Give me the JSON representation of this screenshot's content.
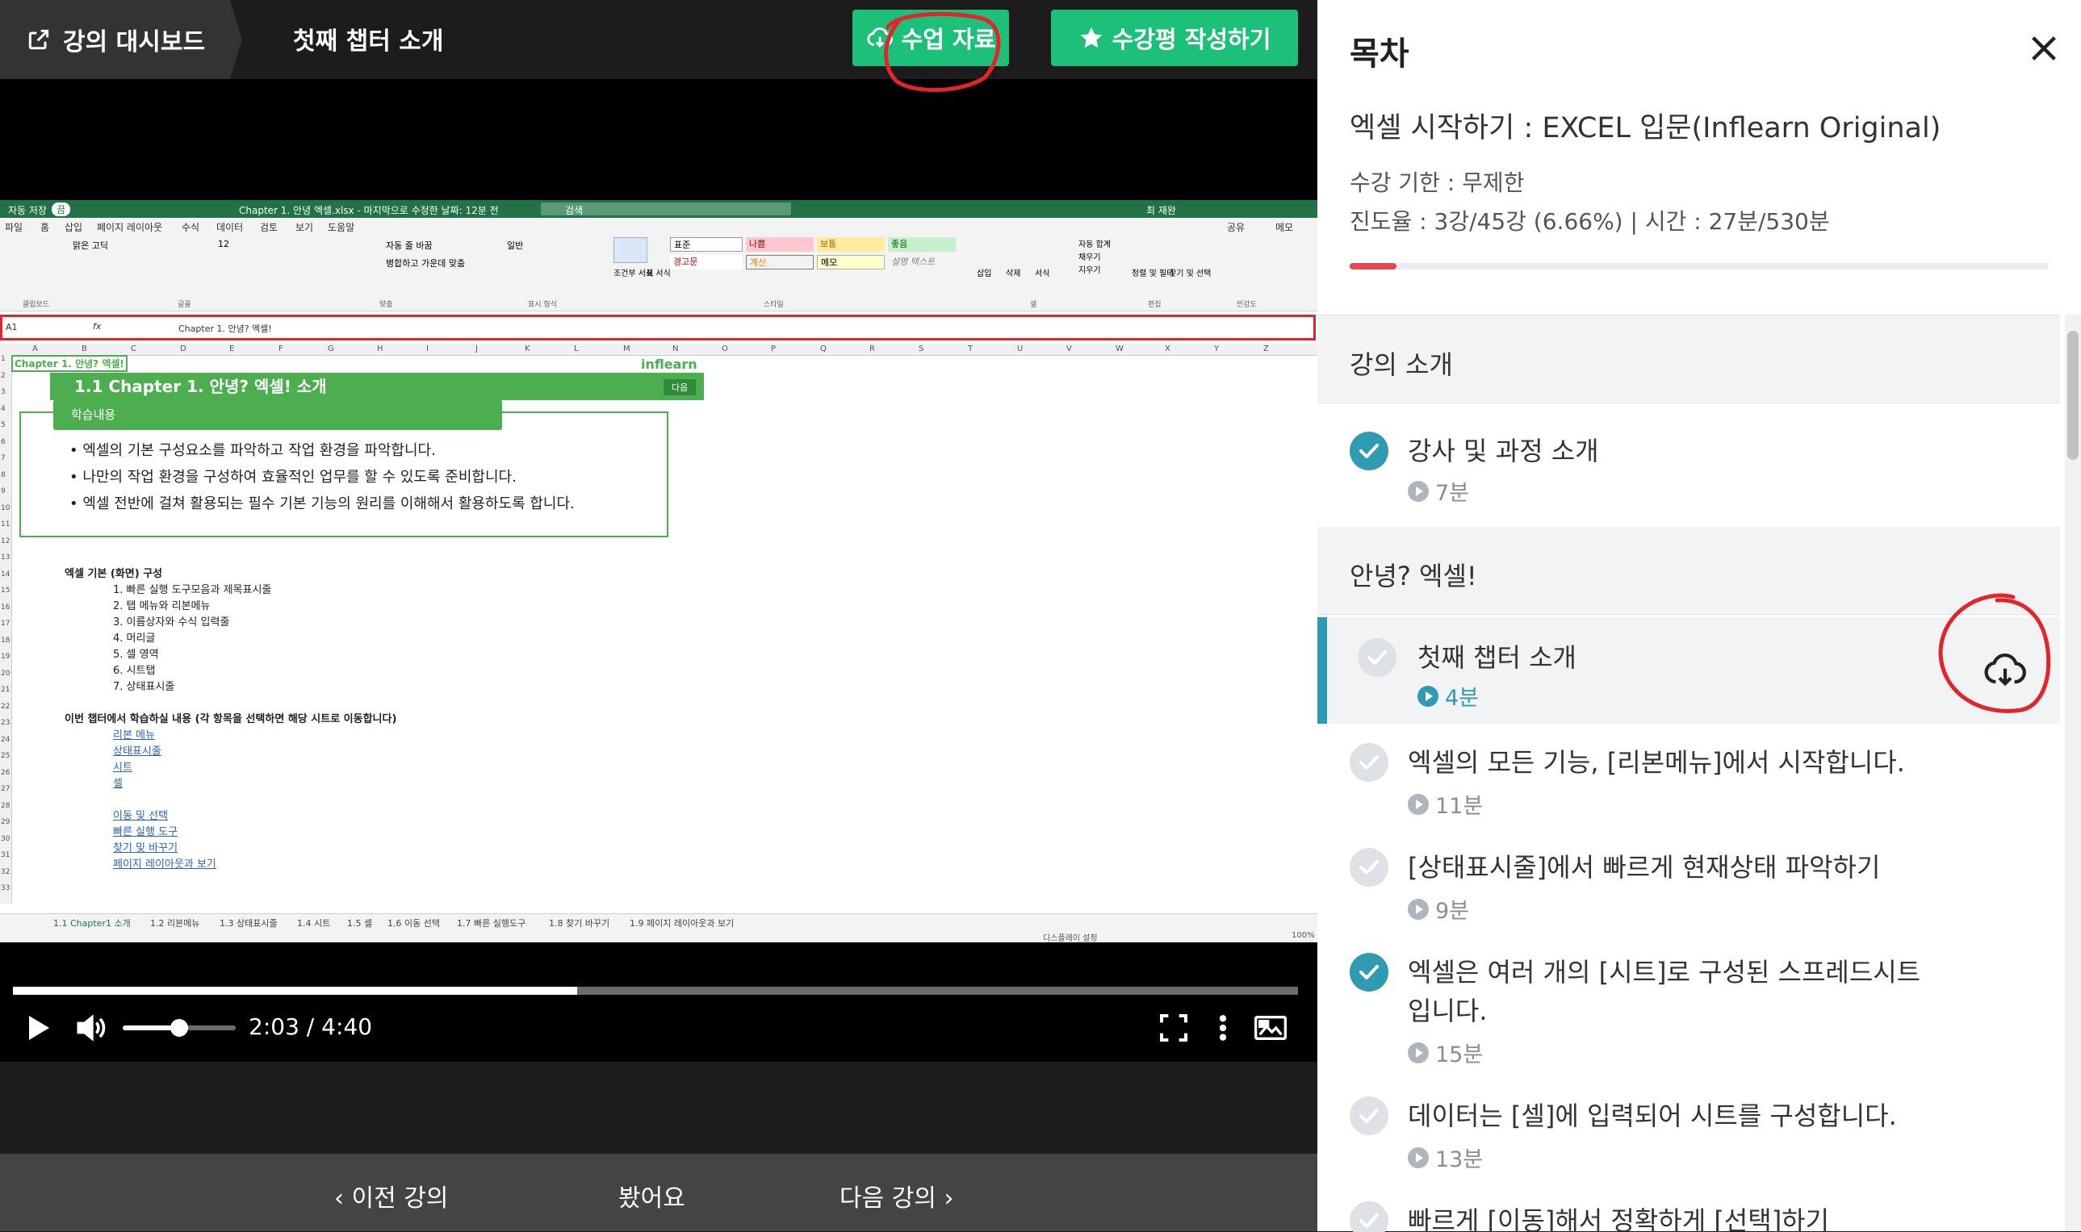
{
  "header": {
    "dashboard_label": "강의 대시보드",
    "chapter_title": "첫째 챕터 소개",
    "material_button": "수업 자료",
    "review_button": "수강평 작성하기"
  },
  "excel": {
    "title_bar": "Chapter 1. 안녕 엑셀.xlsx - 마지막으로 수정한 날짜: 12분 전",
    "search": "검색",
    "user": "최 재완",
    "autosave": "자동 저장",
    "autosave_state": "끔",
    "share": "공유",
    "memo": "메모",
    "menu": [
      "파일",
      "홈",
      "삽입",
      "페이지 레이아웃",
      "수식",
      "데이터",
      "검토",
      "보기",
      "도움말"
    ],
    "ribbon": {
      "font_name": "맑은 고딕",
      "font_size": "12",
      "wrap": "자동 줄 바꿈",
      "merge": "병합하고 가운데 맞춤",
      "number_format": "일반",
      "styles": [
        "표준",
        "나쁨",
        "보통",
        "좋음",
        "경고문",
        "계산",
        "메모",
        "설명 텍스트"
      ],
      "cond_format": "조건부 서식",
      "table_format": "표 서식",
      "cell_insert": "삽입",
      "cell_delete": "삭제",
      "cell_format": "서식",
      "autosum": "자동 합계",
      "fill": "채우기",
      "clear": "지우기",
      "sort": "정렬 및 필터",
      "find": "찾기 및 선택",
      "groups": [
        "클립보드",
        "글꼴",
        "맞춤",
        "표시 형식",
        "스타일",
        "셀",
        "편집",
        "민감도"
      ]
    },
    "name_box": "A1",
    "formula": "Chapter 1. 안녕? 엑셀!",
    "columns": [
      "A",
      "B",
      "C",
      "D",
      "E",
      "F",
      "G",
      "H",
      "I",
      "J",
      "K",
      "L",
      "M",
      "N",
      "O",
      "P",
      "Q",
      "R",
      "S",
      "T",
      "U",
      "V",
      "W",
      "X",
      "Y",
      "Z"
    ],
    "a1_text": "Chapter 1. 안녕? 엑셀!",
    "banner": "1.1 Chapter 1. 안녕? 엑셀! 소개",
    "logo": "inflearn",
    "next_btn": "다음",
    "box_title": "학습내용",
    "bullets": [
      "엑셀의 기본 구성요소를 파악하고 작업 환경을 파악합니다.",
      "나만의 작업 환경을 구성하여 효율적인 업무를 할 수 있도록 준비합니다.",
      "엑셀 전반에 걸쳐 활용되는 필수 기본 기능의 원리를 이해해서 활용하도록 합니다."
    ],
    "section1_title": "엑셀 기본 (화면) 구성",
    "section1_items": [
      "1. 빠른 실행 도구모음과 제목표시줄",
      "2. 탭 메뉴와 리본메뉴",
      "3. 이름상자와 수식 입력줄",
      "4. 머리글",
      "5. 셀 영역",
      "6. 시트탭",
      "7. 상태표시줄"
    ],
    "section2_title": "이번 챕터에서 학습하실 내용 (각 항목을 선택하면 해당 시트로 이동합니다)",
    "links1": [
      "리본 메뉴",
      "상태표시줄",
      "시트",
      "셀"
    ],
    "links2": [
      "이동 및 선택",
      "빠른 실행 도구",
      "찾기 및 바꾸기",
      "페이지 레이아웃과 보기"
    ],
    "sheet_tabs": [
      "1.1 Chapter1 소개",
      "1.2 리본메뉴",
      "1.3 상태표시줄",
      "1.4 시트",
      "1.5 셀",
      "1.6 이동 선택",
      "1.7 빠른 실행도구",
      "1.8 찾기 바꾸기",
      "1.9 페이지 레이아웃과 보기"
    ],
    "status_display": "디스플레이 설정",
    "zoom": "100%"
  },
  "player": {
    "current_time": "2:03",
    "separator": "/",
    "duration": "4:40",
    "progress": 0.4393,
    "volume": 0.5
  },
  "footer": {
    "prev": "이전 강의",
    "watched": "봤어요",
    "next": "다음 강의"
  },
  "panel": {
    "title": "목차",
    "course_title": "엑셀 시작하기 : EXCEL 입문(Inflearn Original)",
    "period": "수강 기한 : 무제한",
    "progress_text": "진도율 : 3강/45강 (6.66%) | 시간 : 27분/530분",
    "progress": 0.0666,
    "sections": [
      {
        "title": "강의 소개",
        "units": [
          {
            "title": "강사 및 과정 소개",
            "duration": "7분",
            "done": true
          }
        ]
      },
      {
        "title": "안녕? 엑셀!",
        "units": [
          {
            "title": "첫째 챕터 소개",
            "duration": "4분",
            "done": false,
            "active": true
          },
          {
            "title": "엑셀의 모든 기능, [리본메뉴]에서 시작합니다.",
            "duration": "11분",
            "done": false
          },
          {
            "title": "[상태표시줄]에서 빠르게 현재상태 파악하기",
            "duration": "9분",
            "done": false
          },
          {
            "title": "엑셀은 여러 개의 [시트]로 구성된 스프레드시트",
            "title2": "입니다.",
            "duration": "15분",
            "done": true
          },
          {
            "title": "데이터는 [셀]에 입력되어 시트를 구성합니다.",
            "duration": "13분",
            "done": false
          },
          {
            "title": "빠르게 [이동]해서 정확하게 [선택]하기",
            "duration": "",
            "done": false
          }
        ]
      }
    ]
  },
  "colors": {
    "accent_green": "#1dc078",
    "teal": "#2f9bb1",
    "progress_red": "#e5484d",
    "annotation_red": "#e2252b",
    "excel_green": "#217346"
  }
}
